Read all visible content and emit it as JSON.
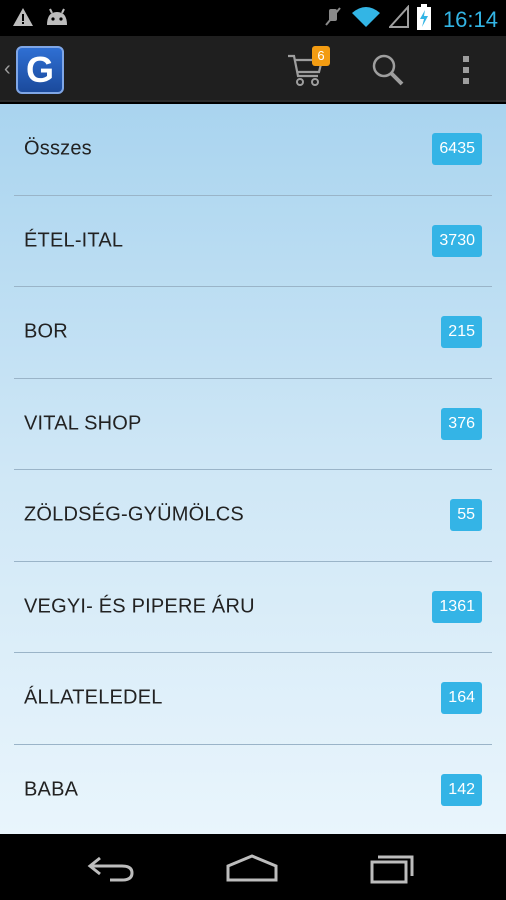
{
  "status_bar": {
    "time": "16:14",
    "icons": [
      "warning-icon",
      "android-debug-icon",
      "mute-icon",
      "wifi-icon",
      "signal-icon",
      "battery-charging-icon"
    ]
  },
  "action_bar": {
    "logo_letter": "G",
    "cart_count": "6",
    "icons": [
      "cart-icon",
      "search-icon",
      "overflow-menu-icon"
    ]
  },
  "categories": [
    {
      "label": "Összes",
      "count": "6435"
    },
    {
      "label": "ÉTEL-ITAL",
      "count": "3730"
    },
    {
      "label": "BOR",
      "count": "215"
    },
    {
      "label": "VITAL SHOP",
      "count": "376"
    },
    {
      "label": "ZÖLDSÉG-GYÜMÖLCS",
      "count": "55"
    },
    {
      "label": "VEGYI- ÉS PIPERE ÁRU",
      "count": "1361"
    },
    {
      "label": "ÁLLATELEDEL",
      "count": "164"
    },
    {
      "label": "BABA",
      "count": "142"
    }
  ],
  "nav_bar": {
    "icons": [
      "back-icon",
      "home-icon",
      "recent-apps-icon"
    ]
  },
  "colors": {
    "accent": "#33b5e5",
    "badge": "#34b4e6",
    "cart_badge": "#f39c12"
  }
}
